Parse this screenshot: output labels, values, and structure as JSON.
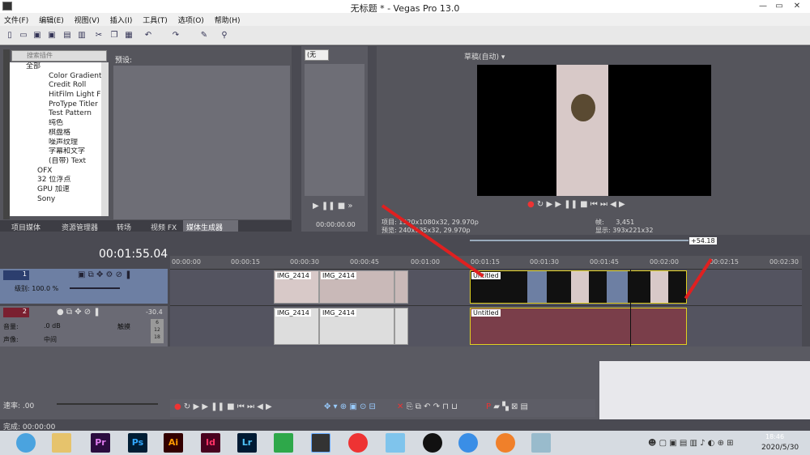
{
  "window": {
    "title": "无标题 * - Vegas Pro 13.0"
  },
  "menu": [
    "文件(F)",
    "编辑(E)",
    "视图(V)",
    "插入(I)",
    "工具(T)",
    "选项(O)",
    "帮助(H)"
  ],
  "media_generators": {
    "search_placeholder": "搜索插件",
    "preset_label": "预设:",
    "tree": [
      "全部",
      "Color Gradient",
      "Credit Roll",
      "HitFilm Light Fla",
      "ProType Titler",
      "Test Pattern",
      "纯色",
      "棋盘格",
      "噪声纹理",
      "字幕和文字",
      "(自带) Text",
      "OFX",
      "32 位浮点",
      "GPU 加速",
      "Sony"
    ],
    "tabs": [
      "项目媒体",
      "资源管理器",
      "转场",
      "视频 FX",
      "媒体生成器"
    ]
  },
  "trimmer": {
    "dropdown": "(无",
    "time": "00:00:00.00"
  },
  "preview": {
    "quality": "草稿(自动)",
    "project_label": "项目:",
    "project_value": "1920x1080x32, 29.970p",
    "preview_label": "预览:",
    "preview_value": "240x135x32, 29.970p",
    "frame_label": "帧:",
    "frame_value": "3,451",
    "display_label": "显示:",
    "display_value": "393x221x32"
  },
  "timeline": {
    "current_time": "00:01:55.04",
    "loop_length": "+54.18",
    "ruler": [
      "00:00:00",
      "00:00:15",
      "00:00:30",
      "00:00:45",
      "00:01:00",
      "00:01:15",
      "00:01:30",
      "00:01:45",
      "00:02:00",
      "00:02:15",
      "00:02:30"
    ],
    "track1": {
      "number": "1",
      "level_label": "级别: 100.0 %"
    },
    "track2": {
      "number": "2",
      "volume_label": "音量:",
      "volume_value": ".0 dB",
      "touch": "触摸",
      "pan_label": "声像:",
      "pan_value": "中间",
      "meter": "-30.4",
      "meter_scale": [
        "6",
        "12",
        "18"
      ]
    },
    "clips": {
      "img": "IMG_2414",
      "untitled": "Untitled"
    },
    "rate_label": "速率: .00"
  },
  "status": {
    "text": "完成: 00:00:00"
  },
  "taskbar": {
    "apps": [
      "Pr",
      "Ps",
      "Ai",
      "Id",
      "Lr"
    ],
    "time": "18:46",
    "date": "2020/5/30"
  },
  "colors": {
    "accent_track": "#6d7fa3",
    "selection": "#e0d020",
    "arrow": "#e02020"
  }
}
